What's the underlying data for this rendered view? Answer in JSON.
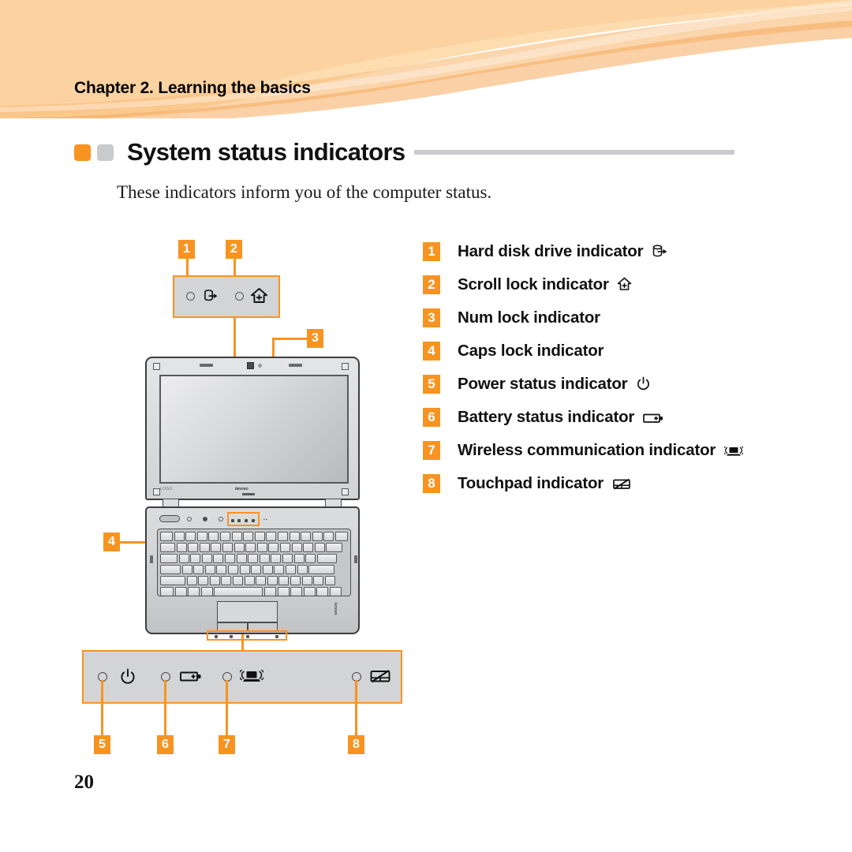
{
  "document": {
    "chapter": "Chapter 2. Learning the basics",
    "section_title": "System status indicators",
    "intro": "These indicators inform you of the computer status.",
    "page_number": "20"
  },
  "colors": {
    "accent_orange": "#F79421",
    "banner_base": "#FDDCB0",
    "banner_mid": "#FACA92",
    "rule_gray": "#C9CACC",
    "device_gray": "#D3D4D6",
    "text_black": "#111111"
  },
  "indicator_list": [
    {
      "number": "1",
      "label": "Hard disk drive indicator",
      "icon": "hard-disk-drive-icon"
    },
    {
      "number": "2",
      "label": "Scroll lock indicator",
      "icon": "scroll-lock-icon"
    },
    {
      "number": "3",
      "label": "Num lock indicator",
      "icon": ""
    },
    {
      "number": "4",
      "label": "Caps lock indicator",
      "icon": ""
    },
    {
      "number": "5",
      "label": "Power status indicator",
      "icon": "power-icon"
    },
    {
      "number": "6",
      "label": "Battery status indicator",
      "icon": "battery-icon"
    },
    {
      "number": "7",
      "label": "Wireless communication indicator",
      "icon": "wireless-icon"
    },
    {
      "number": "8",
      "label": "Touchpad indicator",
      "icon": "touchpad-icon"
    }
  ],
  "diagram": {
    "top_panel": {
      "callouts": [
        "1",
        "2"
      ],
      "indicators": [
        "hard-disk-drive-icon",
        "scroll-lock-icon"
      ]
    },
    "laptop": {
      "lid_brand": "lenovo",
      "lid_logo_left": "LOGO",
      "base_brand": "lenovo",
      "keyboard_callout": "4",
      "screen_callout": "3"
    },
    "bottom_panel": {
      "callouts": [
        "5",
        "6",
        "7",
        "8"
      ],
      "indicators": [
        "power-icon",
        "battery-icon",
        "wireless-icon",
        "touchpad-icon"
      ]
    }
  }
}
